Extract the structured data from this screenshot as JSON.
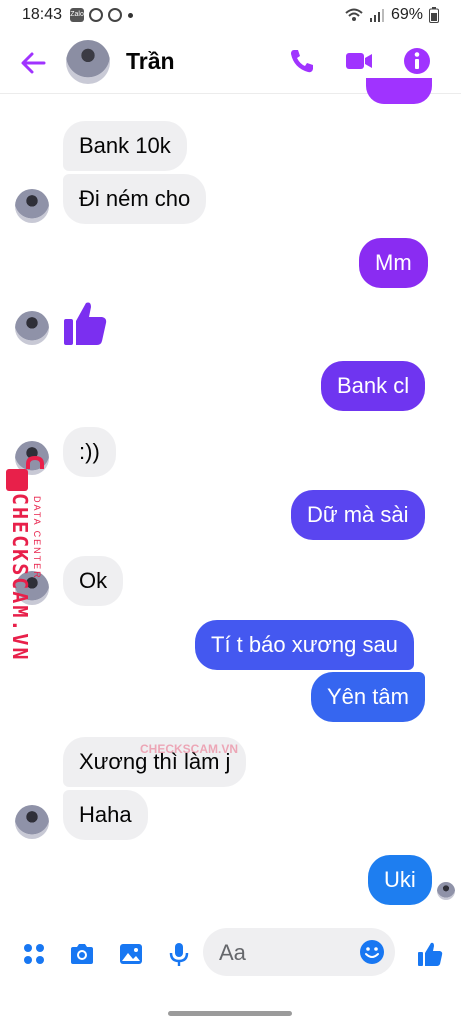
{
  "status_bar": {
    "time": "18:43",
    "battery": "69%"
  },
  "header": {
    "contact_name": "Trần"
  },
  "messages": [
    {
      "side": "in",
      "text": "Bank 10k"
    },
    {
      "side": "in",
      "text": "Đi ném cho"
    },
    {
      "side": "out",
      "text": "Mm"
    },
    {
      "side": "in",
      "text": "thumbs-up-icon"
    },
    {
      "side": "out",
      "text": "Bank cl"
    },
    {
      "side": "in",
      "text": ":))"
    },
    {
      "side": "out",
      "text": "Dữ mà sài"
    },
    {
      "side": "in",
      "text": "Ok"
    },
    {
      "side": "out",
      "text": "Tí t báo xương sau"
    },
    {
      "side": "out",
      "text": "Yên tâm"
    },
    {
      "side": "in",
      "text": "Xương thì làm j"
    },
    {
      "side": "in",
      "text": "Haha"
    },
    {
      "side": "out",
      "text": "Uki"
    }
  ],
  "watermark": {
    "brand": "CHECKSCAM.VN",
    "subtitle": "DATA CENTER"
  },
  "composer": {
    "placeholder": "Aa"
  },
  "colors": {
    "accent": "#a033ff",
    "bubble_purple": "#7b2ff0",
    "bubble_violet": "#6a3ef0",
    "bubble_blue": "#4a58f0",
    "bubble_blue2": "#2f6cf0",
    "bubble_sky": "#1e7ef0",
    "incoming": "#efeff1",
    "watermark": "#e8204a"
  }
}
